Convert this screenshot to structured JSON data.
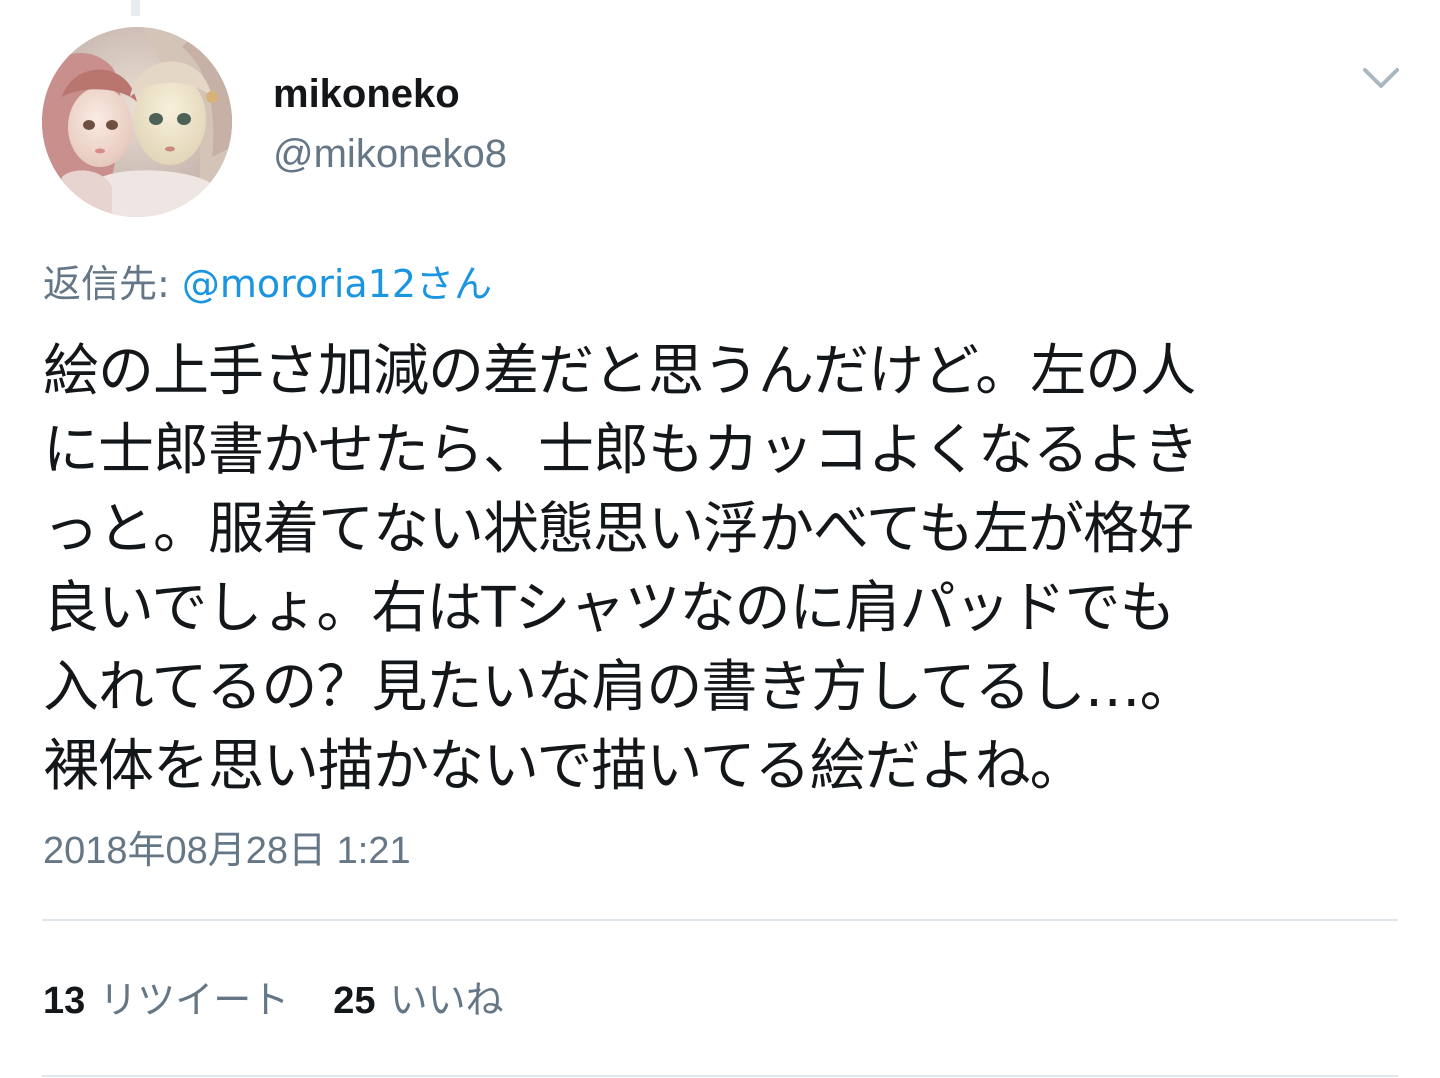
{
  "tweet": {
    "author": {
      "display_name": "mikoneko",
      "handle": "@mikoneko8",
      "avatar_icon": "doll-photo-avatar"
    },
    "menu_icon": "chevron-down-icon",
    "reply_to": {
      "prefix": "返信先: ",
      "mention": "@mororia12さん"
    },
    "text": "絵の上手さ加減の差だと思うんだけど。左の人\nに士郎書かせたら、士郎もカッコよくなるよき\nっと。服着てない状態思い浮かべても左が格好\n良いでしょ。右はTシャツなのに肩パッドでも\n入れてるの？見たいな肩の書き方してるし…。\n裸体を思い描かないで描いてる絵だよね。",
    "timestamp": "2018年08月28日 1:21",
    "stats": {
      "retweets": {
        "count": "13",
        "label": "リツイート"
      },
      "likes": {
        "count": "25",
        "label": "いいね"
      }
    }
  },
  "colors": {
    "text": "#14171a",
    "secondary": "#657786",
    "link": "#1b95e0",
    "divider": "#e1e8ed"
  }
}
